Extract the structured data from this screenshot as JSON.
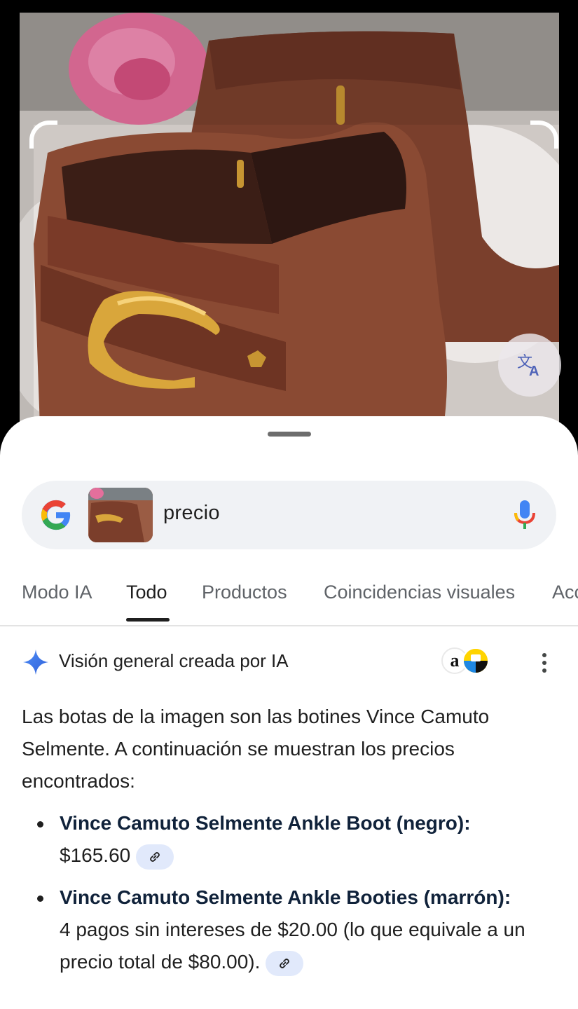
{
  "lens": {
    "translate_icon": "translate-icon"
  },
  "search": {
    "query": "precio",
    "logo_icon": "google-g-icon",
    "mic_icon": "mic-icon"
  },
  "tabs": [
    {
      "label": "Modo IA"
    },
    {
      "label": "Todo"
    },
    {
      "label": "Productos"
    },
    {
      "label": "Coincidencias visuales"
    },
    {
      "label": "Acc"
    }
  ],
  "active_tab": "Todo",
  "ai_overview": {
    "title": "Visión general creada por IA",
    "sparkle_icon": "ai-sparkle-icon",
    "sources": [
      "amazon-icon",
      "shop-icon"
    ],
    "intro": "Las botas de la imagen son las botines Vince Camuto Selmente. A continuación se muestran los precios encontrados:",
    "items": [
      {
        "title": "Vince Camuto Selmente Ankle Boot (negro):",
        "detail": "$165.60"
      },
      {
        "title": "Vince Camuto Selmente Ankle Booties (marrón):",
        "detail": "4 pagos sin intereses de $20.00 (lo que equivale a un precio total de $80.00)."
      }
    ]
  },
  "colors": {
    "accent_blue": "#4285f4",
    "link_chip_bg": "#e1e9fb",
    "boot_brown": "#7a3f2c"
  }
}
